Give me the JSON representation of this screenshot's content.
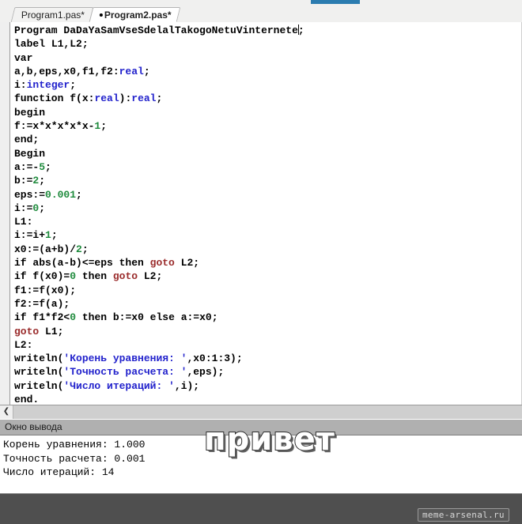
{
  "window": {
    "tabs": [
      {
        "label": "Program1.pas*",
        "active": false,
        "modified": true
      },
      {
        "label": "Program2.pas*",
        "active": true,
        "modified": true
      }
    ]
  },
  "editor": {
    "caret_line": 0,
    "code_lines": [
      [
        {
          "t": "Program ",
          "c": "kw"
        },
        {
          "t": "DaDaYaSamVseSdelalTakogoNetuVinternete",
          "c": "pl"
        },
        {
          "t": "CARET",
          "c": "caret"
        },
        {
          "t": ";",
          "c": "pl"
        }
      ],
      [
        {
          "t": "label ",
          "c": "kw"
        },
        {
          "t": "L1,L2;",
          "c": "pl"
        }
      ],
      [
        {
          "t": "var",
          "c": "kw"
        }
      ],
      [
        {
          "t": "a,b,eps,x0,f1,f2:",
          "c": "pl"
        },
        {
          "t": "real",
          "c": "typ"
        },
        {
          "t": ";",
          "c": "pl"
        }
      ],
      [
        {
          "t": "i:",
          "c": "pl"
        },
        {
          "t": "integer",
          "c": "typ"
        },
        {
          "t": ";",
          "c": "pl"
        }
      ],
      [
        {
          "t": "function ",
          "c": "kw"
        },
        {
          "t": "f(x:",
          "c": "pl"
        },
        {
          "t": "real",
          "c": "typ"
        },
        {
          "t": "):",
          "c": "pl"
        },
        {
          "t": "real",
          "c": "typ"
        },
        {
          "t": ";",
          "c": "pl"
        }
      ],
      [
        {
          "t": "begin",
          "c": "kw"
        }
      ],
      [
        {
          "t": "f:=x*x*x*x*x-",
          "c": "pl"
        },
        {
          "t": "1",
          "c": "num"
        },
        {
          "t": ";",
          "c": "pl"
        }
      ],
      [
        {
          "t": "end;",
          "c": "kw"
        }
      ],
      [
        {
          "t": "Begin",
          "c": "kw"
        }
      ],
      [
        {
          "t": "a:=-",
          "c": "pl"
        },
        {
          "t": "5",
          "c": "num"
        },
        {
          "t": ";",
          "c": "pl"
        }
      ],
      [
        {
          "t": "b:=",
          "c": "pl"
        },
        {
          "t": "2",
          "c": "num"
        },
        {
          "t": ";",
          "c": "pl"
        }
      ],
      [
        {
          "t": "eps:=",
          "c": "pl"
        },
        {
          "t": "0.001",
          "c": "num"
        },
        {
          "t": ";",
          "c": "pl"
        }
      ],
      [
        {
          "t": "i:=",
          "c": "pl"
        },
        {
          "t": "0",
          "c": "num"
        },
        {
          "t": ";",
          "c": "pl"
        }
      ],
      [
        {
          "t": "L1:",
          "c": "pl"
        }
      ],
      [
        {
          "t": "i:=i+",
          "c": "pl"
        },
        {
          "t": "1",
          "c": "num"
        },
        {
          "t": ";",
          "c": "pl"
        }
      ],
      [
        {
          "t": "x0:=(a+b)/",
          "c": "pl"
        },
        {
          "t": "2",
          "c": "num"
        },
        {
          "t": ";",
          "c": "pl"
        }
      ],
      [
        {
          "t": "if ",
          "c": "kw"
        },
        {
          "t": "abs(a-b)<=eps ",
          "c": "pl"
        },
        {
          "t": "then ",
          "c": "kw"
        },
        {
          "t": "goto ",
          "c": "got"
        },
        {
          "t": "L2;",
          "c": "pl"
        }
      ],
      [
        {
          "t": "if ",
          "c": "kw"
        },
        {
          "t": "f(x0)=",
          "c": "pl"
        },
        {
          "t": "0",
          "c": "num"
        },
        {
          "t": " ",
          "c": "pl"
        },
        {
          "t": "then ",
          "c": "kw"
        },
        {
          "t": "goto ",
          "c": "got"
        },
        {
          "t": "L2;",
          "c": "pl"
        }
      ],
      [
        {
          "t": "f1:=f(x0);",
          "c": "pl"
        }
      ],
      [
        {
          "t": "f2:=f(a);",
          "c": "pl"
        }
      ],
      [
        {
          "t": "if ",
          "c": "kw"
        },
        {
          "t": "f1*f2<",
          "c": "pl"
        },
        {
          "t": "0",
          "c": "num"
        },
        {
          "t": " ",
          "c": "pl"
        },
        {
          "t": "then ",
          "c": "kw"
        },
        {
          "t": "b:=x0 ",
          "c": "pl"
        },
        {
          "t": "else ",
          "c": "kw"
        },
        {
          "t": "a:=x0;",
          "c": "pl"
        }
      ],
      [
        {
          "t": "goto ",
          "c": "got"
        },
        {
          "t": "L1;",
          "c": "pl"
        }
      ],
      [
        {
          "t": "L2:",
          "c": "pl"
        }
      ],
      [
        {
          "t": "writeln(",
          "c": "pl"
        },
        {
          "t": "'Корень уравнения: '",
          "c": "str"
        },
        {
          "t": ",x0:1:3);",
          "c": "pl"
        }
      ],
      [
        {
          "t": "writeln(",
          "c": "pl"
        },
        {
          "t": "'Точность расчета: '",
          "c": "str"
        },
        {
          "t": ",eps);",
          "c": "pl"
        }
      ],
      [
        {
          "t": "writeln(",
          "c": "pl"
        },
        {
          "t": "'Число итераций: '",
          "c": "str"
        },
        {
          "t": ",i);",
          "c": "pl"
        }
      ],
      [
        {
          "t": "end.",
          "c": "kw"
        }
      ]
    ]
  },
  "scrollbar": {
    "left_arrow_glyph": "❮"
  },
  "output": {
    "title": "Окно вывода",
    "lines": [
      "Корень уравнения: 1.000",
      "Точность расчета: 0.001",
      "Число итераций: 14"
    ]
  },
  "overlay": {
    "meme_text": "привет",
    "watermark": "meme-arsenal.ru"
  },
  "colors": {
    "keyword": "#000000",
    "type": "#2222cc",
    "string": "#2222cc",
    "number": "#1f8b3d",
    "goto": "#9a2b2b",
    "accent_bar": "#2b7cb0",
    "output_header": "#b0b0b0",
    "footer": "#4f4f4f"
  }
}
